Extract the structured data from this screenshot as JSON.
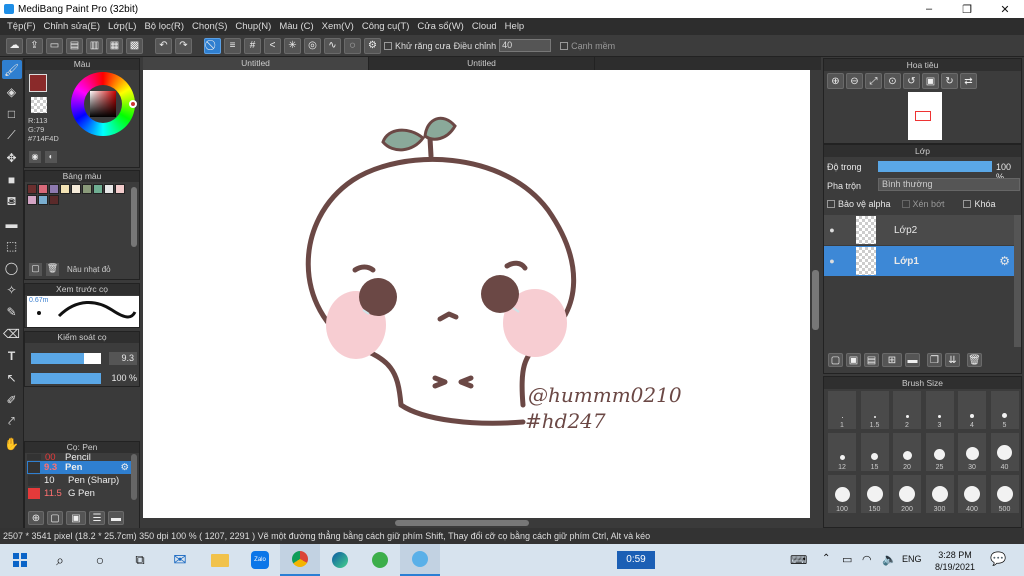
{
  "window": {
    "title": "MediBang Paint Pro (32bit)",
    "min": "–",
    "max": "❐",
    "close": "✕"
  },
  "menu": [
    "Tệp(F)",
    "Chỉnh sửa(E)",
    "Lớp(L)",
    "Bộ lọc(R)",
    "Chọn(S)",
    "Chụp(N)",
    "Màu (C)",
    "Xem(V)",
    "Công cụ(T)",
    "Cửa sổ(W)",
    "Cloud",
    "Help"
  ],
  "toolbar": {
    "antialias_label": "Khử răng cưa",
    "adjust_label": "Điều chỉnh",
    "adjust_value": "40",
    "edge_label": "Cạnh mềm"
  },
  "tools": [
    "brush-tool",
    "eraser-tool",
    "rectangle-tool",
    "pen-line-tool",
    "move-tool",
    "fill-rect-tool",
    "bucket-tool",
    "gradient-tool",
    "select-rect-tool",
    "lasso-tool",
    "magic-wand-tool",
    "select-pen-tool",
    "select-eraser-tool",
    "text-tool",
    "operation-tool",
    "divide-tool",
    "eyedropper-tool",
    "hand-tool"
  ],
  "color_panel": {
    "title": "Màu",
    "r": "R:113",
    "g": "G:79",
    "hex": "#714F4D",
    "primary": "#8a2a2a"
  },
  "palette": {
    "title": "Bảng màu",
    "selected_name": "Nâu nhạt đỏ",
    "swatches": [
      "#6b2f2f",
      "#d86a7a",
      "#8e7ab0",
      "#f2e2b4",
      "#f4ead8",
      "#8a9a7a",
      "#6fae92",
      "#e8e8e8",
      "#f3cccc",
      "#d4a5c5",
      "#7aaed0",
      "#5a2a2a"
    ]
  },
  "brush_preview": {
    "title": "Xem trước cọ",
    "size": "0.67m"
  },
  "brush_control": {
    "title": "Kiểm soát cọ",
    "size_value": "9.3",
    "opacity_value": "100 %",
    "size_fraction": 0.75,
    "opacity_fraction": 1.0
  },
  "brush_list": {
    "title": "Cọ: Pen",
    "items": [
      {
        "size": "00",
        "name": "Pencil",
        "color": "#333"
      },
      {
        "size": "9.3",
        "name": "Pen",
        "color": "#e53a3a"
      },
      {
        "size": "10",
        "name": "Pen (Sharp)",
        "color": "#333"
      },
      {
        "size": "11.5",
        "name": "G Pen",
        "color": "#e53a3a"
      }
    ]
  },
  "tabs": [
    "Untitled",
    "Untitled"
  ],
  "canvas": {
    "signature_line1": "@hummm0210",
    "signature_line2": "#hd247"
  },
  "navigator": {
    "title": "Hoa tiêu"
  },
  "layers": {
    "title": "Lớp",
    "opacity_label": "Độ trong",
    "opacity_value": "100 %",
    "opacity_fraction": 1.0,
    "blend_label": "Pha trộn",
    "blend_value": "Bình thường",
    "protect_alpha": "Bảo vệ alpha",
    "clipping": "Xén bớt",
    "lock": "Khóa",
    "items": [
      {
        "name": "Lớp2"
      },
      {
        "name": "Lớp1"
      }
    ]
  },
  "brush_size": {
    "title": "Brush Size",
    "sizes": [
      "1",
      "1.5",
      "2",
      "3",
      "4",
      "5",
      "12",
      "15",
      "20",
      "25",
      "30",
      "40",
      "100",
      "150",
      "200",
      "300",
      "400",
      "500"
    ]
  },
  "status": {
    "text": "2507 * 3541 pixel   (18.2 * 25.7cm)   350 dpi   100 %   ( 1207, 2291 )   Vẽ một đường thẳng bằng cách giữ phím Shift, Thay đổi cỡ cọ bằng cách giữ phím Ctrl, Alt và kéo"
  },
  "taskbar": {
    "timer": "0:59",
    "lang": "ENG",
    "time": "3:28 PM",
    "date": "8/19/2021"
  }
}
